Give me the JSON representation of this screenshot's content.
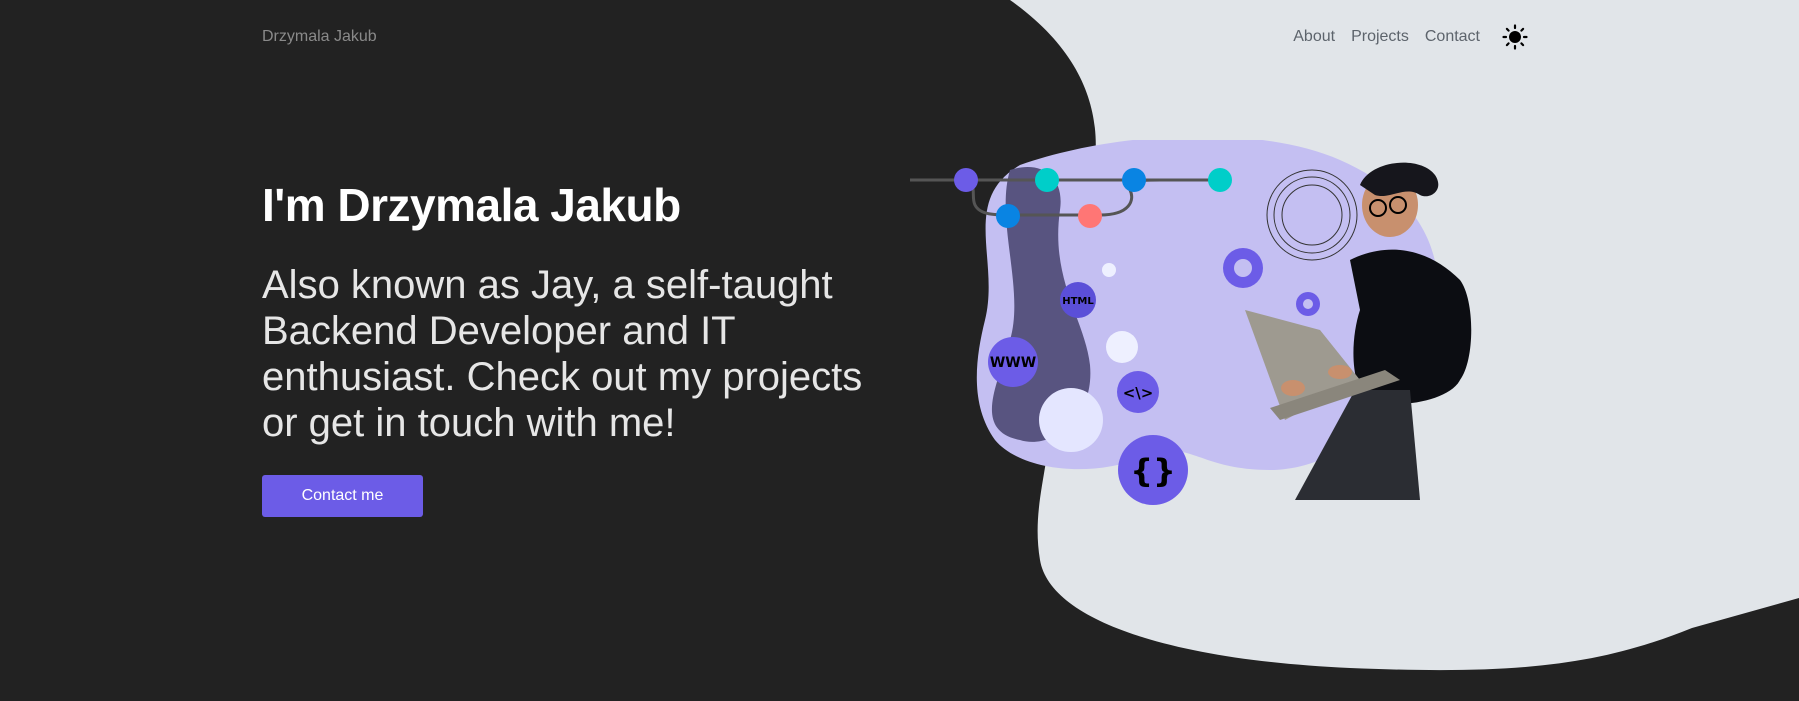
{
  "nav": {
    "brand": "Drzymala Jakub",
    "links": [
      "About",
      "Projects",
      "Contact"
    ],
    "theme_icon": "sun-icon"
  },
  "hero": {
    "title": "I'm Drzymala Jakub",
    "subtitle": "Also known as Jay, a self-taught Backend Developer and IT enthusiast. Check out my projects or get in touch with me!",
    "cta_label": "Contact me"
  },
  "illustration": {
    "badges": [
      "HTML",
      "WWW",
      "<\\>",
      "{}"
    ],
    "icons": [
      "git-graph-icon",
      "gear-icon",
      "developer-with-laptop-icon"
    ]
  },
  "colors": {
    "background_dark": "#222222",
    "background_light": "#e1e5e9",
    "accent": "#6c5ce7",
    "blob": "#c4bff2"
  }
}
